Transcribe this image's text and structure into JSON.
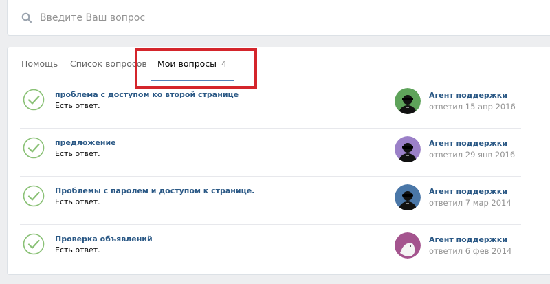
{
  "search": {
    "placeholder": "Введите Ваш вопрос"
  },
  "tabs": [
    {
      "label": "Помощь"
    },
    {
      "label": "Список вопросов"
    },
    {
      "label": "Мои вопросы",
      "count": "4"
    }
  ],
  "questions": [
    {
      "title": "проблема с доступом ко второй странице",
      "status": "Есть ответ.",
      "agent": "Агент поддержки",
      "date": "ответил 15 апр 2016"
    },
    {
      "title": "предложение",
      "status": "Есть ответ.",
      "agent": "Агент поддержки",
      "date": "ответил 29 янв 2016"
    },
    {
      "title": "Проблемы с паролем и доступом к странице.",
      "status": "Есть ответ.",
      "agent": "Агент поддержки",
      "date": "ответил 7 мар 2014"
    },
    {
      "title": "Проверка объявлений",
      "status": "Есть ответ.",
      "agent": "Агент поддержки",
      "date": "ответил 6 фев 2014"
    }
  ],
  "colors": {
    "link": "#2a5885",
    "check": "#8ac176",
    "highlight": "#d4252b",
    "avatar_1": "#5ea35a",
    "avatar_2": "#9b80c8",
    "avatar_3": "#4a77a8",
    "avatar_4": "#a4548e"
  }
}
